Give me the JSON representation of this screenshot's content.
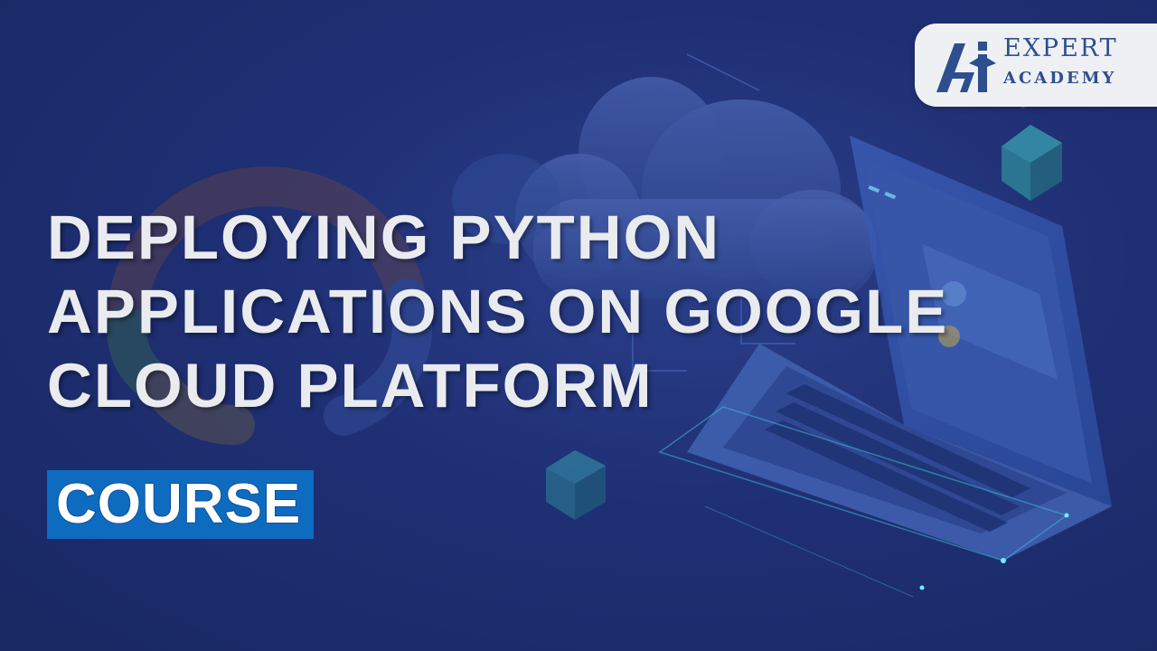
{
  "logo": {
    "line1": "EXPERT",
    "line2": "ACADEMY",
    "primary_color": "#2e4f8d",
    "box_color": "#eef0f4"
  },
  "title": {
    "lines": [
      "DEPLOYING PYTHON",
      "APPLICATIONS ON GOOGLE",
      "CLOUD PLATFORM"
    ],
    "color": "#e9ebef"
  },
  "badge": {
    "label": "COURSE",
    "background_color": "#0e6cc0"
  },
  "theme": {
    "background_color": "#1d2c6b"
  }
}
